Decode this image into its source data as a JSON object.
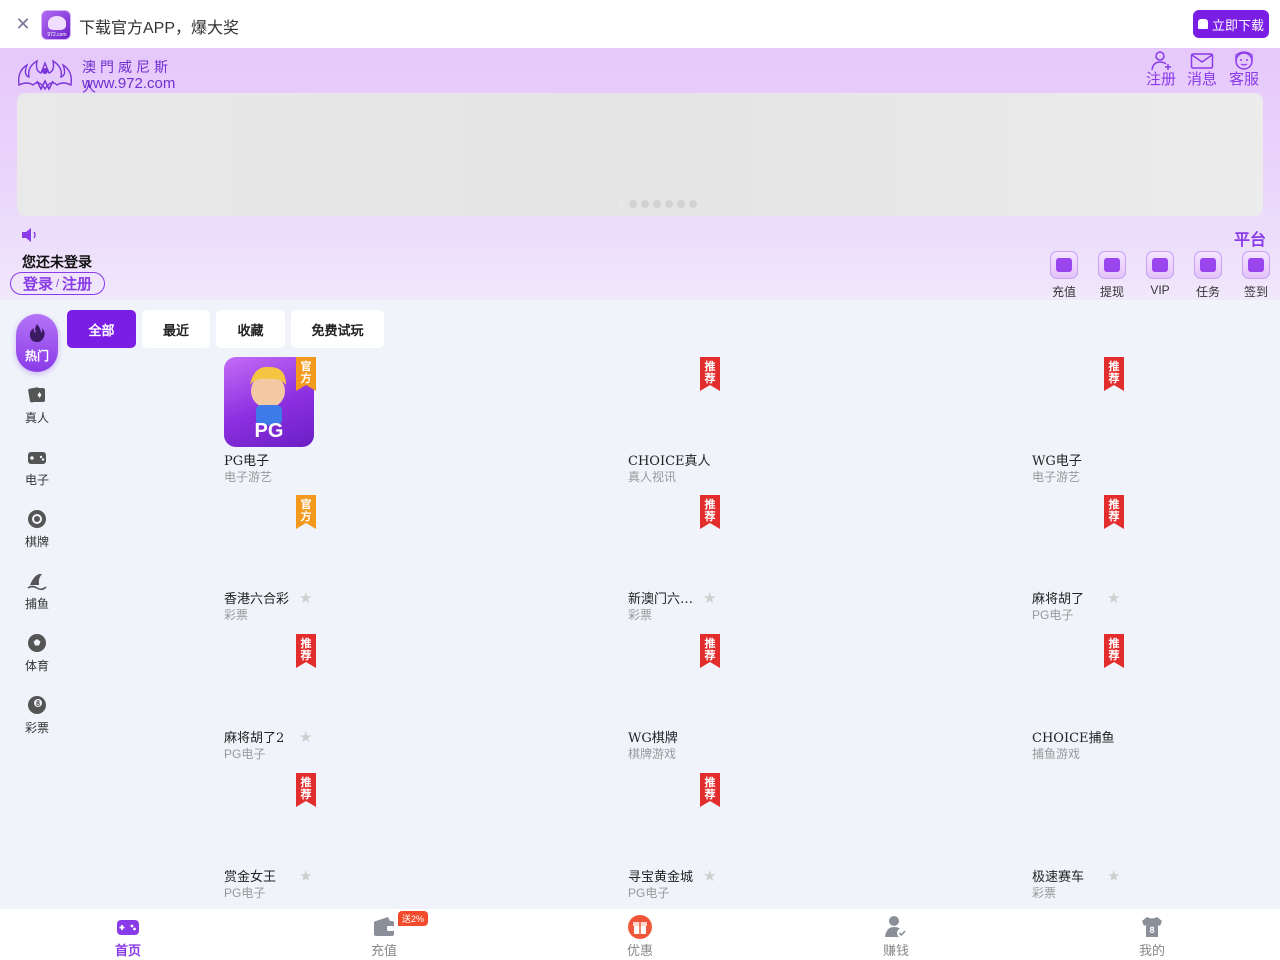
{
  "topbar": {
    "promo_text": "下载官方APP，爆大奖",
    "download_label": "立即下载",
    "app_domain": "972.com"
  },
  "header": {
    "logo_cn": "澳門威尼斯人",
    "logo_url": "www.972.com",
    "actions": [
      {
        "label": "注册",
        "icon": "user-add-icon"
      },
      {
        "label": "消息",
        "icon": "envelope-icon"
      },
      {
        "label": "客服",
        "icon": "support-agent-icon"
      }
    ]
  },
  "banner": {
    "dot_count": 7
  },
  "account": {
    "platform_label": "平台",
    "status_text": "您还未登录",
    "login_label": "登录",
    "separator": "/",
    "register_label": "注册"
  },
  "quick_actions": [
    {
      "label": "充值",
      "icon": "wallet-icon"
    },
    {
      "label": "提现",
      "icon": "withdraw-icon"
    },
    {
      "label": "VIP",
      "icon": "crown-icon"
    },
    {
      "label": "任务",
      "icon": "task-icon"
    },
    {
      "label": "签到",
      "icon": "checkin-icon"
    }
  ],
  "categories": [
    {
      "label": "热门",
      "icon": "flame-icon",
      "active": true
    },
    {
      "label": "真人",
      "icon": "cards-icon"
    },
    {
      "label": "电子",
      "icon": "gamepad-icon"
    },
    {
      "label": "棋牌",
      "icon": "chip-icon"
    },
    {
      "label": "捕鱼",
      "icon": "shark-fin-icon"
    },
    {
      "label": "体育",
      "icon": "soccer-ball-icon"
    },
    {
      "label": "彩票",
      "icon": "eight-ball-icon"
    }
  ],
  "filters": [
    {
      "label": "全部",
      "active": true
    },
    {
      "label": "最近"
    },
    {
      "label": "收藏"
    },
    {
      "label": "免费试玩"
    }
  ],
  "games": [
    {
      "title": "PG电子",
      "sub": "电子游艺",
      "badge": "官方",
      "star": false,
      "pg_logo": "PG"
    },
    {
      "title": "CHOICE真人",
      "sub": "真人视讯",
      "badge": "推荐",
      "star": false
    },
    {
      "title": "WG电子",
      "sub": "电子游艺",
      "badge": "推荐",
      "star": false
    },
    {
      "title": "香港六合彩",
      "sub": "彩票",
      "badge": "官方",
      "star": true
    },
    {
      "title": "新澳门六…",
      "sub": "彩票",
      "badge": "推荐",
      "star": true
    },
    {
      "title": "麻将胡了",
      "sub": "PG电子",
      "badge": "推荐",
      "star": true
    },
    {
      "title": "麻将胡了2",
      "sub": "PG电子",
      "badge": "推荐",
      "star": true
    },
    {
      "title": "WG棋牌",
      "sub": "棋牌游戏",
      "badge": "推荐",
      "star": false
    },
    {
      "title": "CHOICE捕鱼",
      "sub": "捕鱼游戏",
      "badge": "推荐",
      "star": false
    },
    {
      "title": "赏金女王",
      "sub": "PG电子",
      "badge": "推荐",
      "star": true
    },
    {
      "title": "寻宝黄金城",
      "sub": "PG电子",
      "badge": "推荐",
      "star": true
    },
    {
      "title": "极速赛车",
      "sub": "彩票",
      "badge": null,
      "star": true
    }
  ],
  "tabbar": [
    {
      "label": "首页",
      "icon": "gamepad-icon",
      "active": true
    },
    {
      "label": "充值",
      "icon": "wallet-icon",
      "chip": "送2%"
    },
    {
      "label": "优惠",
      "icon": "gift-icon"
    },
    {
      "label": "赚钱",
      "icon": "user-check-icon"
    },
    {
      "label": "我的",
      "icon": "jersey-icon",
      "jersey_number": "8"
    }
  ],
  "colors": {
    "brand": "#7a1ee6",
    "accent": "#8a3be8",
    "badge_official": "#f39a1e",
    "badge_recommend": "#e32d2d"
  }
}
